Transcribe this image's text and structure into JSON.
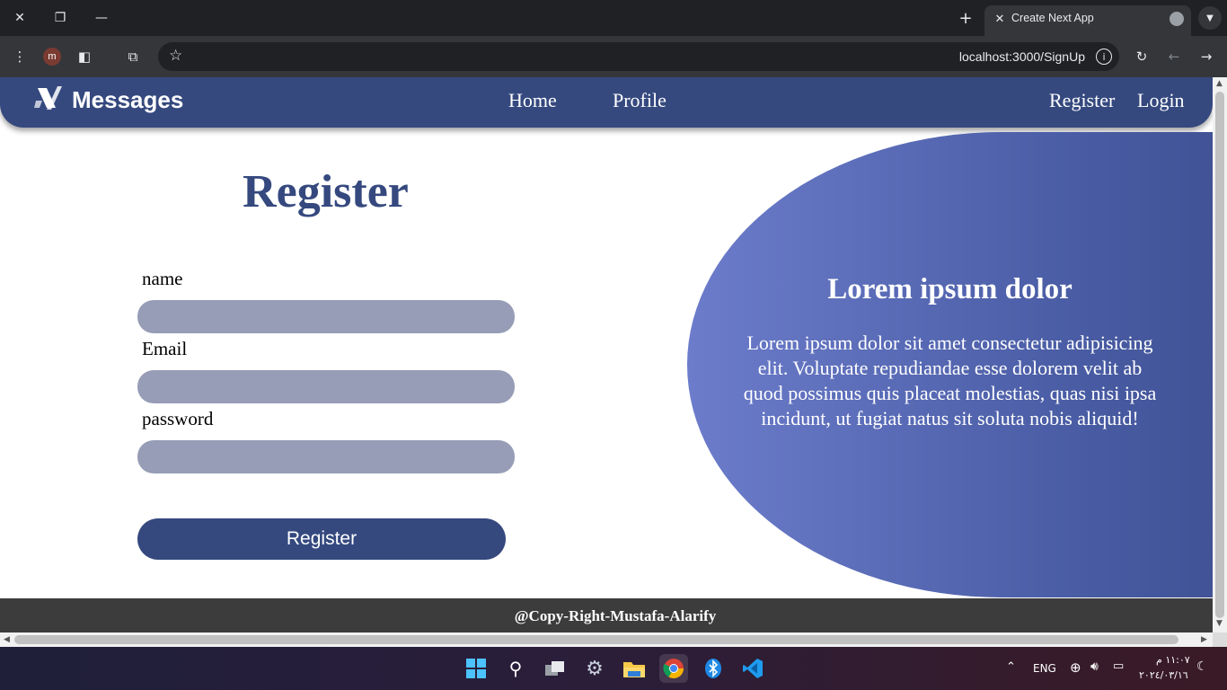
{
  "browser": {
    "tab_title": "Create Next App",
    "url": "localhost:3000/SignUp",
    "profile_initial": "m",
    "new_tab_icon": "+",
    "close_icon": "✕"
  },
  "navbar": {
    "brand": "Messages",
    "links": [
      "Home",
      "Profile"
    ],
    "auth": [
      "Register",
      "Login"
    ]
  },
  "form": {
    "title": "Register",
    "fields": [
      {
        "label": "name",
        "value": ""
      },
      {
        "label": "Email",
        "value": ""
      },
      {
        "label": "password",
        "value": ""
      }
    ],
    "submit_label": "Register"
  },
  "hero": {
    "title": "Lorem ipsum dolor",
    "text": "Lorem ipsum dolor sit amet consectetur adipisicing elit. Voluptate repudiandae esse dolorem velit ab quod possimus quis placeat molestias, quas nisi ipsa incidunt, ut fugiat natus sit soluta nobis aliquid!"
  },
  "footer": {
    "text": "@Copy-Right-Mustafa-Alarify"
  },
  "taskbar": {
    "language": "ENG",
    "time": "١١:٠٧ م",
    "date": "٢٠٢٤/٠٣/١٦"
  },
  "colors": {
    "primary": "#35497f",
    "input_bg": "#979db6",
    "footer_bg": "#3c3c3c"
  }
}
